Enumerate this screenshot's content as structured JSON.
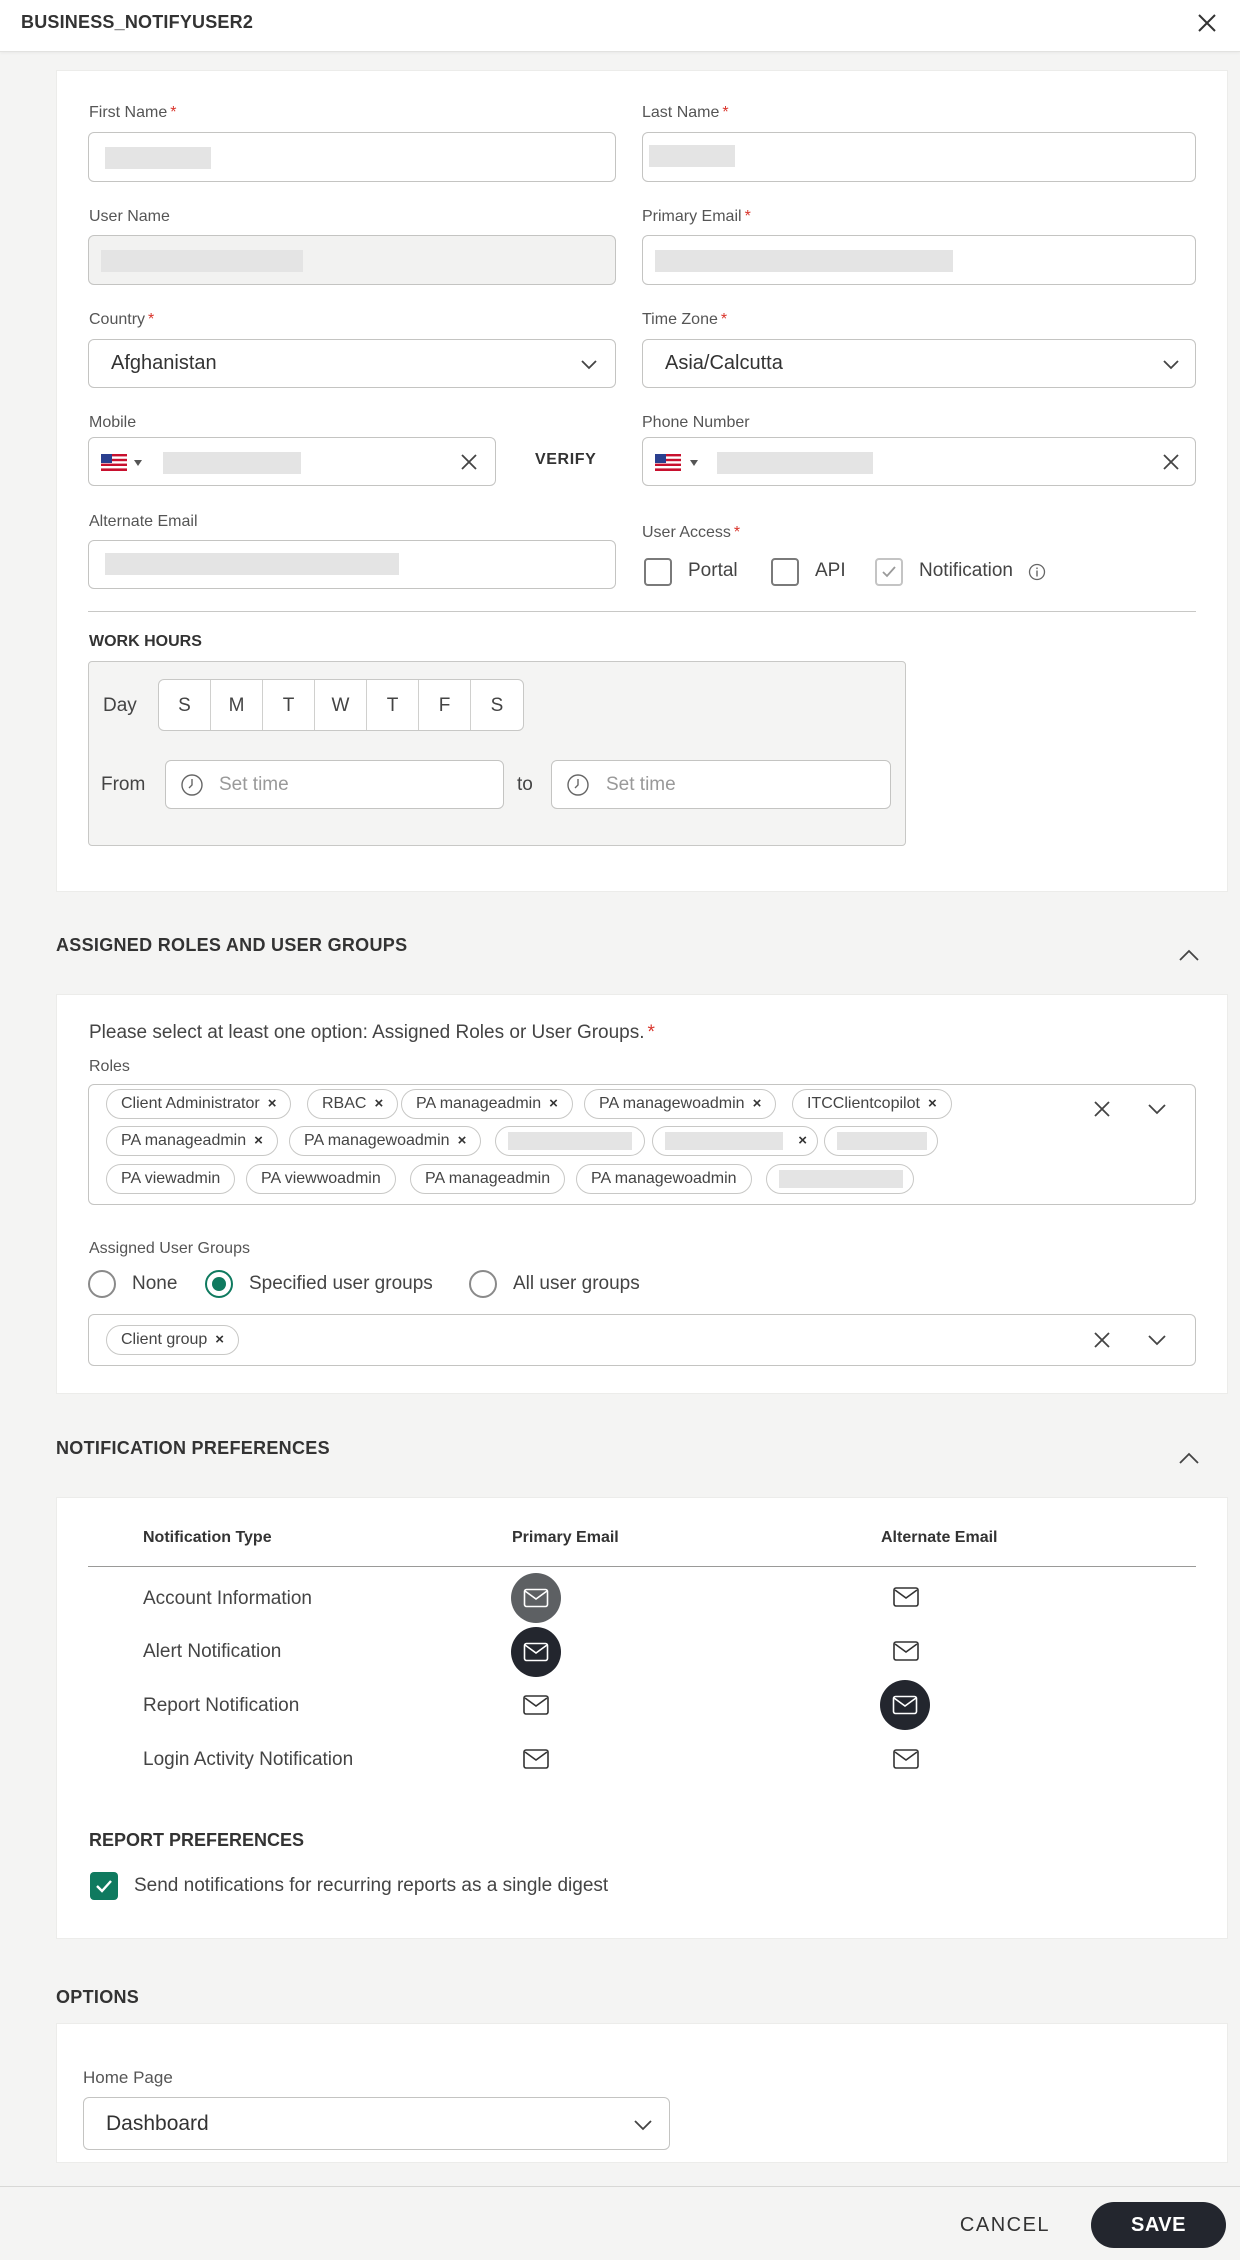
{
  "header": {
    "title": "BUSINESS_NOTIFYUSER2"
  },
  "user_form": {
    "first_name_label": "First Name",
    "last_name_label": "Last Name",
    "user_name_label": "User Name",
    "primary_email_label": "Primary Email",
    "country_label": "Country",
    "country_value": "Afghanistan",
    "timezone_label": "Time Zone",
    "timezone_value": "Asia/Calcutta",
    "mobile_label": "Mobile",
    "verify_label": "VERIFY",
    "phone_label": "Phone Number",
    "alt_email_label": "Alternate Email",
    "required_mark": "*",
    "user_access": {
      "label": "User Access",
      "options": [
        "Portal",
        "API",
        "Notification"
      ],
      "checked": [
        false,
        false,
        true
      ]
    }
  },
  "work_hours": {
    "title": "WORK HOURS",
    "day_label": "Day",
    "days": [
      "S",
      "M",
      "T",
      "W",
      "T",
      "F",
      "S"
    ],
    "from_label": "From",
    "to_label": "to",
    "from_placeholder": "Set time",
    "to_placeholder": "Set time"
  },
  "roles_section": {
    "title": "ASSIGNED ROLES AND USER GROUPS",
    "instruction": "Please select at least one option: Assigned Roles or User Groups.",
    "roles_label": "Roles",
    "roles_row1": [
      "Client Administrator",
      "RBAC",
      "PA manageadmin",
      "PA managewoadmin",
      "ITCClientcopilot"
    ],
    "roles_row2": [
      "PA manageadmin",
      "PA managewoadmin"
    ],
    "roles_row3": [
      "PA viewadmin",
      "PA viewwoadmin",
      "PA manageadmin",
      "PA managewoadmin"
    ],
    "groups_label": "Assigned User Groups",
    "group_options": [
      "None",
      "Specified user groups",
      "All user groups"
    ],
    "selected_group_option": "Specified user groups",
    "groups": [
      "Client group"
    ]
  },
  "notifications": {
    "title": "NOTIFICATION PREFERENCES",
    "col_type": "Notification Type",
    "col_primary": "Primary Email",
    "col_alternate": "Alternate Email",
    "rows": [
      {
        "type": "Account Information",
        "primary": "selected-grey",
        "alternate": "unselected"
      },
      {
        "type": "Alert Notification",
        "primary": "selected",
        "alternate": "unselected"
      },
      {
        "type": "Report Notification",
        "primary": "unselected",
        "alternate": "selected"
      },
      {
        "type": "Login Activity Notification",
        "primary": "unselected",
        "alternate": "unselected"
      }
    ],
    "report_prefs_title": "REPORT PREFERENCES",
    "digest_label": "Send notifications for recurring reports as a single digest",
    "digest_checked": true
  },
  "options": {
    "title": "OPTIONS",
    "home_page_label": "Home Page",
    "home_page_value": "Dashboard"
  },
  "footer": {
    "cancel_label": "CANCEL",
    "save_label": "SAVE"
  },
  "colors": {
    "accent_green": "#0f7a5f",
    "dark": "#23262e",
    "required": "#d9342b"
  }
}
